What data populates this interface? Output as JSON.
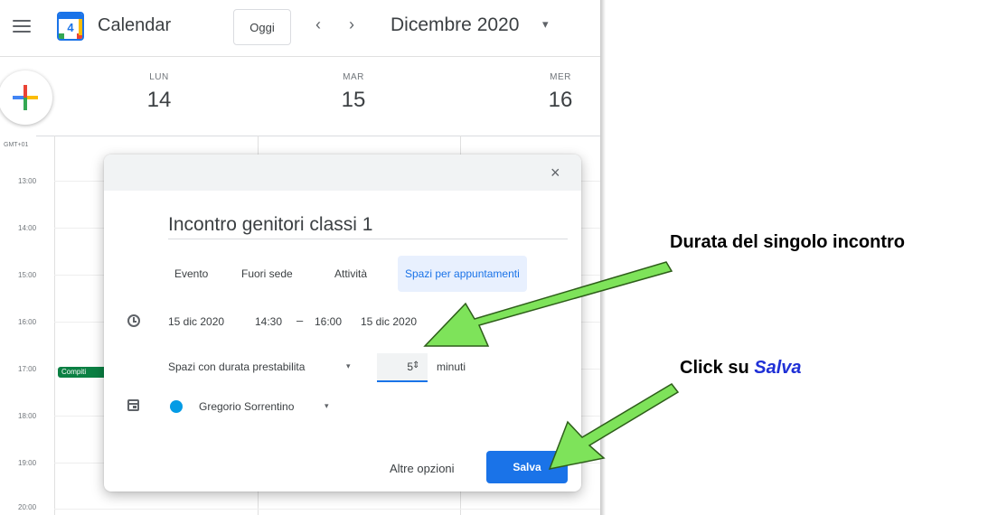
{
  "header": {
    "app_title": "Calendar",
    "logo_day": "4",
    "today_button": "Oggi",
    "prev_arrow": "‹",
    "next_arrow": "›",
    "month_title": "Dicembre 2020",
    "month_caret": "▾"
  },
  "days": [
    {
      "name": "LUN",
      "num": "14"
    },
    {
      "name": "MAR",
      "num": "15"
    },
    {
      "name": "MER",
      "num": "16"
    }
  ],
  "timezone": "GMT+01",
  "hours": [
    "13:00",
    "14:00",
    "15:00",
    "16:00",
    "17:00",
    "18:00",
    "19:00",
    "20:00"
  ],
  "event_chip": "Compiti",
  "dialog": {
    "close": "×",
    "title": "Incontro genitori classi 1",
    "tabs": [
      "Evento",
      "Fuori sede",
      "Attività",
      "Spazi per appuntamenti"
    ],
    "start_date": "15 dic 2020",
    "start_time": "14:30",
    "dash": "–",
    "end_time": "16:00",
    "end_date": "15 dic 2020",
    "slot_mode": "Spazi con durata prestabilita",
    "caret": "▾",
    "duration": "5",
    "spin": "⇕",
    "minutes_label": "minuti",
    "owner": "Gregorio Sorrentino",
    "more_options": "Altre opzioni",
    "save": "Salva"
  },
  "annotations": {
    "callout_1": "Durata del singolo incontro",
    "callout_2_prefix": "Click su ",
    "callout_2_emph": "Salva",
    "arrow_color": "#7ee35a"
  }
}
